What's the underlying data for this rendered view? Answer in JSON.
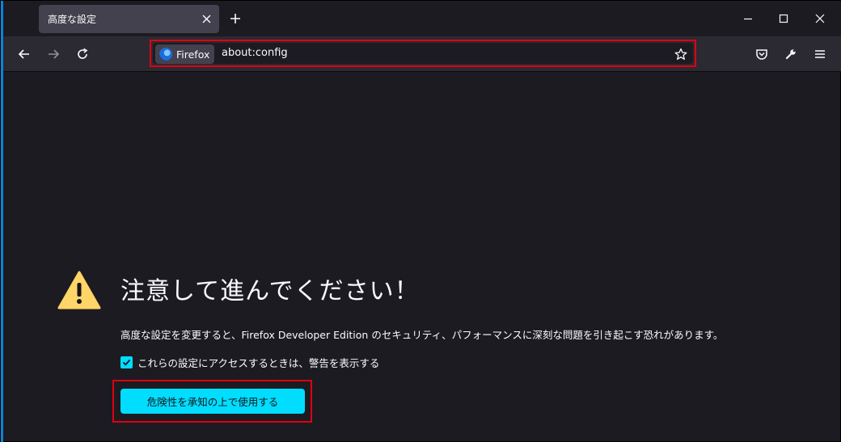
{
  "tab": {
    "title": "高度な設定",
    "close_icon": "close-icon"
  },
  "window_controls": [
    "minimize-icon",
    "maximize-icon",
    "close-icon"
  ],
  "urlbar": {
    "identity_label": "Firefox",
    "url": "about:config"
  },
  "toolbar_icons": [
    "pocket-icon",
    "wrench-icon",
    "hamburger-menu-icon"
  ],
  "warning": {
    "title": "注意して進んでください！",
    "description": "高度な設定を変更すると、Firefox Developer Edition のセキュリティ、パフォーマンスに深刻な問題を引き起こす恐れがあります。",
    "checkbox_label": "これらの設定にアクセスするときは、警告を表示する",
    "checkbox_checked": true,
    "accept_button": "危険性を承知の上で使用する"
  },
  "colors": {
    "background": "#1c1b22",
    "toolbar": "#2b2a33",
    "accent": "#00ddff",
    "warning_icon": "#ffd567",
    "highlight_frame": "#e0000f"
  }
}
